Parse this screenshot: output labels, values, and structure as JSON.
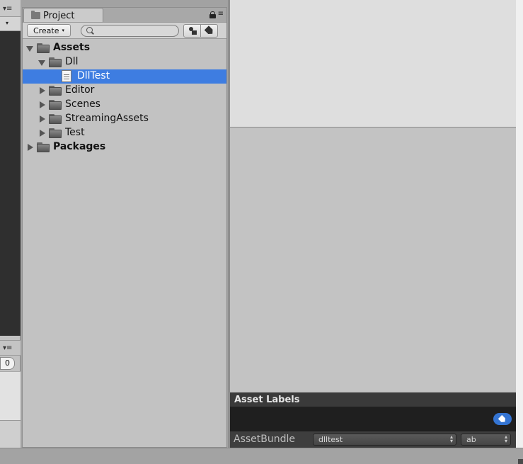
{
  "left_panel": {
    "menu_glyph": "▾≡",
    "dropdown_glyph": "▾",
    "number_value": "0"
  },
  "project": {
    "tab_label": "Project",
    "create_label": "Create",
    "create_caret": "▾",
    "search_placeholder": "",
    "menu_glyph": "≡",
    "tree": [
      {
        "label": "Assets",
        "depth": 0,
        "expanded": true,
        "type": "folder",
        "bold": true,
        "selected": false
      },
      {
        "label": "Dll",
        "depth": 1,
        "expanded": true,
        "type": "folder",
        "bold": false,
        "selected": false
      },
      {
        "label": "DllTest",
        "depth": 2,
        "expanded": null,
        "type": "file",
        "bold": false,
        "selected": true
      },
      {
        "label": "Editor",
        "depth": 1,
        "expanded": false,
        "type": "folder",
        "bold": false,
        "selected": false
      },
      {
        "label": "Scenes",
        "depth": 1,
        "expanded": false,
        "type": "folder",
        "bold": false,
        "selected": false
      },
      {
        "label": "StreamingAssets",
        "depth": 1,
        "expanded": false,
        "type": "folder",
        "bold": false,
        "selected": false
      },
      {
        "label": "Test",
        "depth": 1,
        "expanded": false,
        "type": "folder",
        "bold": false,
        "selected": false
      },
      {
        "label": "Packages",
        "depth": 0,
        "expanded": false,
        "type": "folder",
        "bold": true,
        "selected": false
      }
    ]
  },
  "inspector": {
    "asset_labels_title": "Asset Labels",
    "assetbundle_label": "AssetBundle",
    "assetbundle_name": "dlltest",
    "assetbundle_variant": "ab",
    "updown_glyph_up": "▴",
    "updown_glyph_down": "▾"
  },
  "colors": {
    "selection": "#3e7de1",
    "tag_button": "#3474d2"
  }
}
